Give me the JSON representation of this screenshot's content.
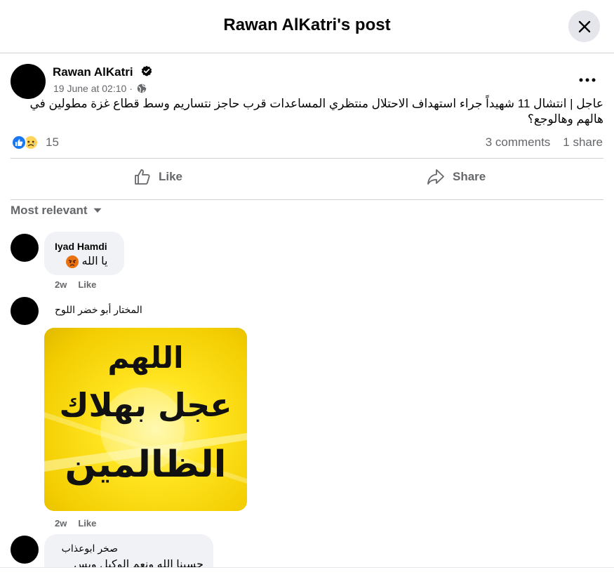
{
  "dialog": {
    "title": "Rawan AlKatri's post",
    "close_icon": "close-icon"
  },
  "post": {
    "author": "Rawan AlKatri",
    "verified_icon": "verified-badge-icon",
    "timestamp": "19 June at 02:10",
    "separator": "·",
    "privacy_icon": "globe-icon",
    "more_icon": "more-options-icon",
    "text": "عاجل | انتشال 11 شهيداً جراء استهداف الاحتلال منتظري المساعدات قرب حاجز نتساريم وسط قطاع غزة مطولين في هالهم وهالوجع؟",
    "reaction_count": "15",
    "reaction_icons": [
      "like-reaction-icon",
      "sad-reaction-icon"
    ],
    "comments_count": "3 comments",
    "shares_count": "1 share"
  },
  "actions": {
    "like_label": "Like",
    "share_label": "Share"
  },
  "sort": {
    "label": "Most relevant"
  },
  "comments": [
    {
      "name": "Iyad Hamdi",
      "text": "يا الله",
      "emoji_icon": "angry-emoji-icon",
      "time": "2w",
      "like_label": "Like"
    },
    {
      "name": "المختار أبو خضر اللوح",
      "image_text": [
        "اللهم",
        "عجل بهلاك",
        "الظالمين"
      ],
      "time": "2w",
      "like_label": "Like"
    },
    {
      "name": "صخر ابوعذاب",
      "text": "حسبنا الله ونعم الوكيل وبس"
    }
  ],
  "colors": {
    "secondary_text": "#65676b",
    "bubble": "#f0f2f5",
    "like_blue": "#1877f2",
    "divider": "#ced0d4"
  }
}
